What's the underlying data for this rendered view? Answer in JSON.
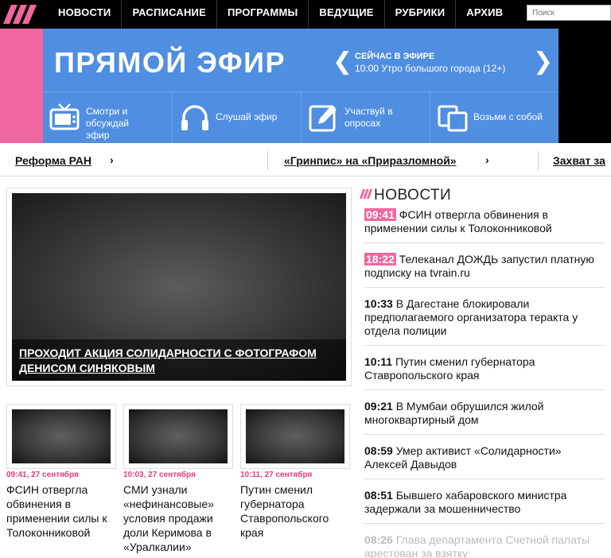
{
  "nav": {
    "items": [
      "НОВОСТИ",
      "РАСПИСАНИЕ",
      "ПРОГРАММЫ",
      "ВЕДУЩИЕ",
      "РУБРИКИ",
      "АРХИВ"
    ],
    "search_placeholder": "Поиск"
  },
  "live": {
    "title": "ПРЯМОЙ ЭФИР",
    "now_label": "СЕЙЧАС В ЭФИРЕ",
    "now_show": "10:00 Утро большого города (12+)",
    "actions": [
      {
        "label": "Смотри и обсуждай эфир",
        "icon": "tv-icon"
      },
      {
        "label": "Слушай эфир",
        "icon": "headphones-icon"
      },
      {
        "label": "Участвуй в опросах",
        "icon": "pencil-icon"
      },
      {
        "label": "Возьми с собой",
        "icon": "devices-icon"
      }
    ]
  },
  "trending": [
    "Реформа РАН",
    "«Гринпис» на «Приразломной»",
    "Захват за"
  ],
  "feature": {
    "title": "ПРОХОДИТ АКЦИЯ СОЛИДАРНОСТИ С ФОТОГРАФОМ ДЕНИСОМ СИНЯКОВЫМ"
  },
  "cards": [
    {
      "time": "09:41, 27 сентября",
      "text": "ФСИН отвергла обвинения в применении силы к Толоконниковой"
    },
    {
      "time": "10:03, 27 сентября",
      "text": "СМИ узнали «нефинансовые» условия продажи доли Керимова в «Уралкалии»"
    },
    {
      "time": "10:11, 27 сентября",
      "text": "Путин сменил губернатора Ставропольского края"
    }
  ],
  "news": {
    "heading": "НОВОСТИ",
    "items": [
      {
        "time": "09:41",
        "text": "ФСИН отвергла обвинения в применении силы к Толоконниковой",
        "highlight": true
      },
      {
        "time": "18:22",
        "text": "Телеканал ДОЖДЬ запустил платную подписку на tvrain.ru",
        "highlight": true
      },
      {
        "time": "10:33",
        "text": "В Дагестане блокировали предполагаемого организатора теракта у отдела полиции",
        "highlight": false
      },
      {
        "time": "10:11",
        "text": "Путин сменил губернатора Ставропольского края",
        "highlight": false
      },
      {
        "time": "09:21",
        "text": "В Мумбаи обрушился жилой многоквартирный дом",
        "highlight": false
      },
      {
        "time": "08:59",
        "text": "Умер активист «Солидарности» Алексей Давыдов",
        "highlight": false
      },
      {
        "time": "08:51",
        "text": "Бывшего хабаровского министра задержали за мошенничество",
        "highlight": false
      },
      {
        "time": "08:26",
        "text": "Глава департамента Счетной палаты арестован за взятку",
        "highlight": false
      }
    ]
  },
  "colors": {
    "accent_pink": "#f0679f",
    "live_blue": "#4f8ee0",
    "nav_black": "#000000"
  }
}
